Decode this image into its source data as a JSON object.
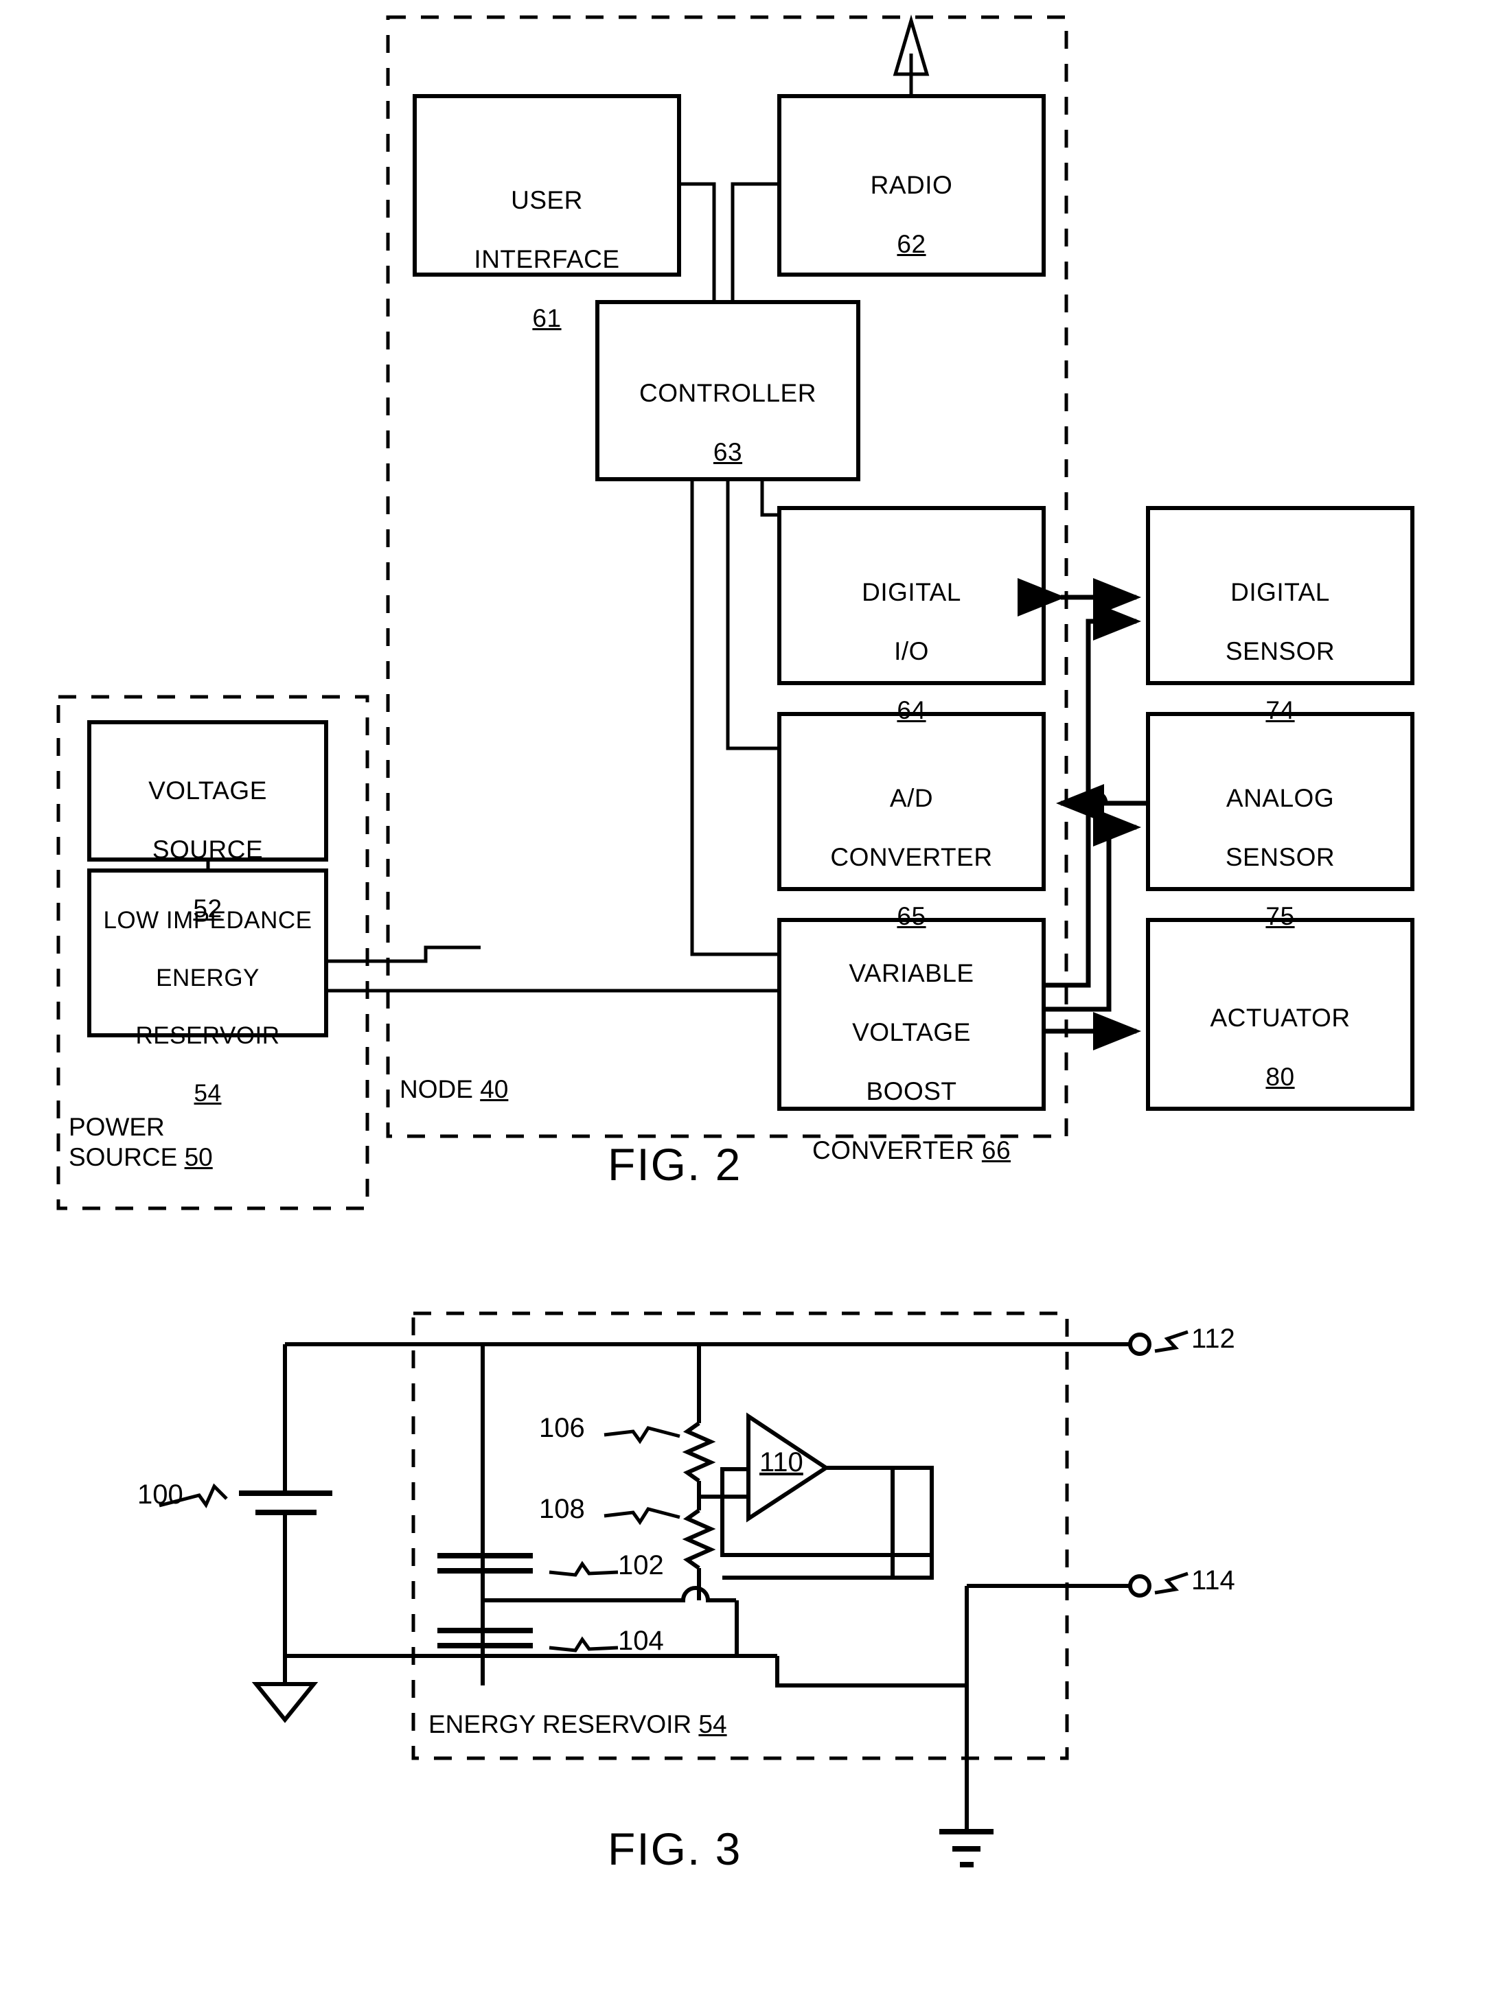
{
  "document": {
    "type": "patent-drawing-sheet",
    "figures": [
      "FIG. 2",
      "FIG. 3"
    ]
  },
  "fig2": {
    "caption": "FIG. 2",
    "node_label": "NODE",
    "node_ref": "40",
    "power_source_label_line1": "POWER",
    "power_source_label_line2": "SOURCE",
    "power_source_ref": "50",
    "blocks": [
      {
        "id": "user-interface",
        "line1": "USER",
        "line2": "INTERFACE",
        "ref": "61"
      },
      {
        "id": "radio",
        "line1": "RADIO",
        "line2": "",
        "ref": "62"
      },
      {
        "id": "controller",
        "line1": "CONTROLLER",
        "line2": "",
        "ref": "63"
      },
      {
        "id": "digital-io",
        "line1": "DIGITAL",
        "line2": "I/O",
        "ref": "64"
      },
      {
        "id": "ad-converter",
        "line1": "A/D",
        "line2": "CONVERTER",
        "ref": "65"
      },
      {
        "id": "variable-voltage-boost-converter",
        "line1": "VARIABLE",
        "line2": "VOLTAGE",
        "line3": "BOOST",
        "line4": "CONVERTER",
        "ref": "66"
      },
      {
        "id": "digital-sensor",
        "line1": "DIGITAL",
        "line2": "SENSOR",
        "ref": "74"
      },
      {
        "id": "analog-sensor",
        "line1": "ANALOG",
        "line2": "SENSOR",
        "ref": "75"
      },
      {
        "id": "actuator",
        "line1": "ACTUATOR",
        "line2": "",
        "ref": "80"
      },
      {
        "id": "voltage-source",
        "line1": "VOLTAGE",
        "line2": "SOURCE",
        "ref": "52"
      },
      {
        "id": "low-impedance-energy-reservoir",
        "line1": "LOW IMPEDANCE",
        "line2": "ENERGY",
        "line3": "RESERVOIR",
        "ref": "54"
      }
    ]
  },
  "fig3": {
    "caption": "FIG. 3",
    "enclosure_label": "ENERGY RESERVOIR",
    "enclosure_ref": "54",
    "components": [
      {
        "id": "battery",
        "ref": "100",
        "symbol": "battery"
      },
      {
        "id": "capacitor-upper",
        "ref": "102",
        "symbol": "capacitor"
      },
      {
        "id": "capacitor-lower",
        "ref": "104",
        "symbol": "capacitor"
      },
      {
        "id": "resistor-upper",
        "ref": "106",
        "symbol": "resistor"
      },
      {
        "id": "resistor-lower",
        "ref": "108",
        "symbol": "resistor"
      },
      {
        "id": "amplifier",
        "ref": "110",
        "symbol": "amplifier"
      },
      {
        "id": "terminal-positive",
        "ref": "112",
        "symbol": "terminal"
      },
      {
        "id": "terminal-negative",
        "ref": "114",
        "symbol": "terminal"
      }
    ]
  },
  "colors": {
    "ink": "#000000",
    "paper": "#ffffff"
  }
}
